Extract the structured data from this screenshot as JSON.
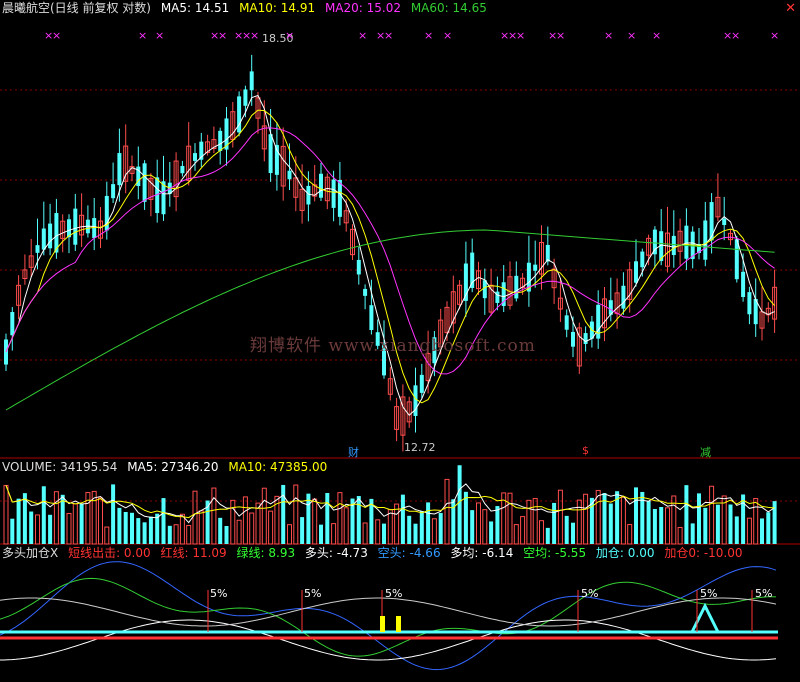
{
  "main": {
    "title": "晨曦航空(日线 前复权 对数)",
    "ma5": "MA5: 14.51",
    "ma10": "MA10: 14.91",
    "ma20": "MA20: 15.02",
    "ma60": "MA60: 14.65",
    "high_label": "18.50",
    "low_label": "12.72",
    "markers": [
      "财",
      "$",
      "减"
    ],
    "watermark": "翔博软件 www.xiangbosoft.com",
    "x_mark": "×"
  },
  "volume": {
    "title": "VOLUME: 34195.54",
    "ma5": "MA5: 27346.20",
    "ma10": "MA10: 47385.00"
  },
  "indicator": {
    "title": "多头加仓X",
    "l1": "短线出击: 0.00",
    "l2": "红线: 11.09",
    "l3": "绿线: 8.93",
    "l4": "多头: -4.73",
    "l5": "空头: -4.66",
    "l6": "多均: -6.14",
    "l7": "空均: -5.55",
    "l8": "加仓: 0.00",
    "l9": "加仓0: -10.00",
    "pct": "5%"
  },
  "colors": {
    "up": "#ff4d4d",
    "down": "#54ffff",
    "ma5": "#ffffff",
    "ma10": "#ffff00",
    "ma20": "#ff33ff",
    "ma60": "#33cc33",
    "grid": "#8b0000"
  },
  "close_icon": "close-icon"
}
